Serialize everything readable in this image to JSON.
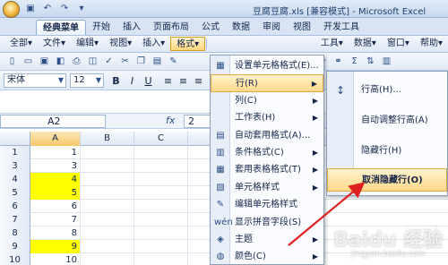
{
  "window": {
    "title": "豆腐豆腐.xls [兼容模式] - Microsoft Excel"
  },
  "ribbon_tabs": [
    "经典菜单",
    "开始",
    "插入",
    "页面布局",
    "公式",
    "数据",
    "审阅",
    "视图",
    "开发工具"
  ],
  "menubar": [
    "全部▾",
    "文件▾",
    "编辑▾",
    "视图▾",
    "插入▾",
    "格式▾",
    "工具▾",
    "数据▾",
    "窗口▾",
    "帮助▾"
  ],
  "format_toolbar": {
    "font": "宋体",
    "font_size": "12",
    "bold": "B",
    "italic": "I",
    "underline": "U"
  },
  "formula_bar": {
    "cell_ref": "A2",
    "fx": "fx",
    "value": "2"
  },
  "sheet": {
    "columns": [
      "A",
      "B",
      "C",
      "D"
    ],
    "rows": [
      {
        "num": "1",
        "a": "1",
        "yellow": false
      },
      {
        "num": "3",
        "a": "3",
        "yellow": false
      },
      {
        "num": "4",
        "a": "4",
        "yellow": true
      },
      {
        "num": "5",
        "a": "5",
        "yellow": true
      },
      {
        "num": "6",
        "a": "6",
        "yellow": false
      },
      {
        "num": "7",
        "a": "7",
        "yellow": false
      },
      {
        "num": "8",
        "a": "8",
        "yellow": false
      },
      {
        "num": "9",
        "a": "9",
        "yellow": true
      },
      {
        "num": "10",
        "a": "10",
        "yellow": false
      }
    ]
  },
  "format_menu": [
    {
      "label": "设置单元格格式(E)...",
      "icon": "format-cells-icon"
    },
    {
      "label": "行(R)",
      "icon": "",
      "submenu": true,
      "highlighted": true
    },
    {
      "label": "列(C)",
      "icon": "",
      "submenu": true
    },
    {
      "label": "工作表(H)",
      "icon": "",
      "submenu": true
    },
    {
      "label": "自动套用格式(A)...",
      "icon": "autoformat-icon"
    },
    {
      "label": "条件格式(C)",
      "icon": "conditional-format-icon",
      "submenu": true
    },
    {
      "label": "套用表格格式(T)",
      "icon": "table-style-icon",
      "submenu": true
    },
    {
      "label": "单元格样式",
      "icon": "cell-style-icon",
      "submenu": true
    },
    {
      "label": "编辑单元格样式",
      "icon": "edit-style-icon"
    },
    {
      "label": "显示拼音字段(S)",
      "icon": "phonetic-icon"
    },
    {
      "label": "主题",
      "icon": "theme-icon",
      "submenu": true
    },
    {
      "label": "颜色(C)",
      "icon": "color-icon",
      "submenu": true
    }
  ],
  "row_submenu": [
    {
      "label": "行高(H)...",
      "icon": "row-height-icon"
    },
    {
      "label": "自动调整行高(A)",
      "icon": ""
    },
    {
      "label": "隐藏行(H)",
      "icon": ""
    },
    {
      "label": "取消隐藏行(O)",
      "icon": "",
      "highlighted": true
    }
  ],
  "colors": {
    "highlight_yellow": "#ffff00",
    "arrow_red": "#e02020",
    "menu_highlight": "#ffd98a"
  },
  "watermark": {
    "text": "Baidu 经验",
    "sub": "jingyan.baidu.com"
  }
}
